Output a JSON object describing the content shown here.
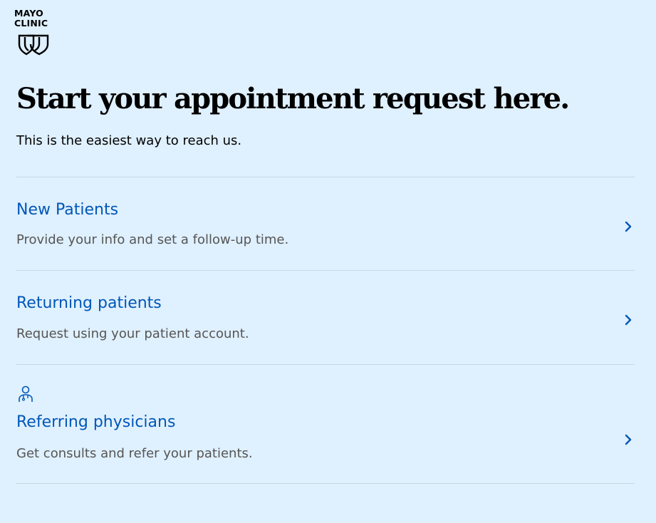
{
  "logo": {
    "line1": "MAYO",
    "line2": "CLINIC",
    "mark_icon": "mayo-shields-icon"
  },
  "header": {
    "title": "Start your appointment request here.",
    "subtitle": "This is the easiest way to reach us."
  },
  "options": [
    {
      "title": "New Patients",
      "description": "Provide your info and set a follow-up time.",
      "icon": "chevron-right-icon"
    },
    {
      "title": "Returning patients",
      "description": "Request using your patient account.",
      "icon": "chevron-right-icon"
    },
    {
      "title": "Referring physicians",
      "description": "Get consults and refer your patients.",
      "leading_icon": "physician-icon",
      "icon": "chevron-right-icon"
    }
  ],
  "colors": {
    "background": "#dff0fe",
    "link": "#0057b8",
    "muted_text": "#555555",
    "divider": "#c8d6e1"
  }
}
